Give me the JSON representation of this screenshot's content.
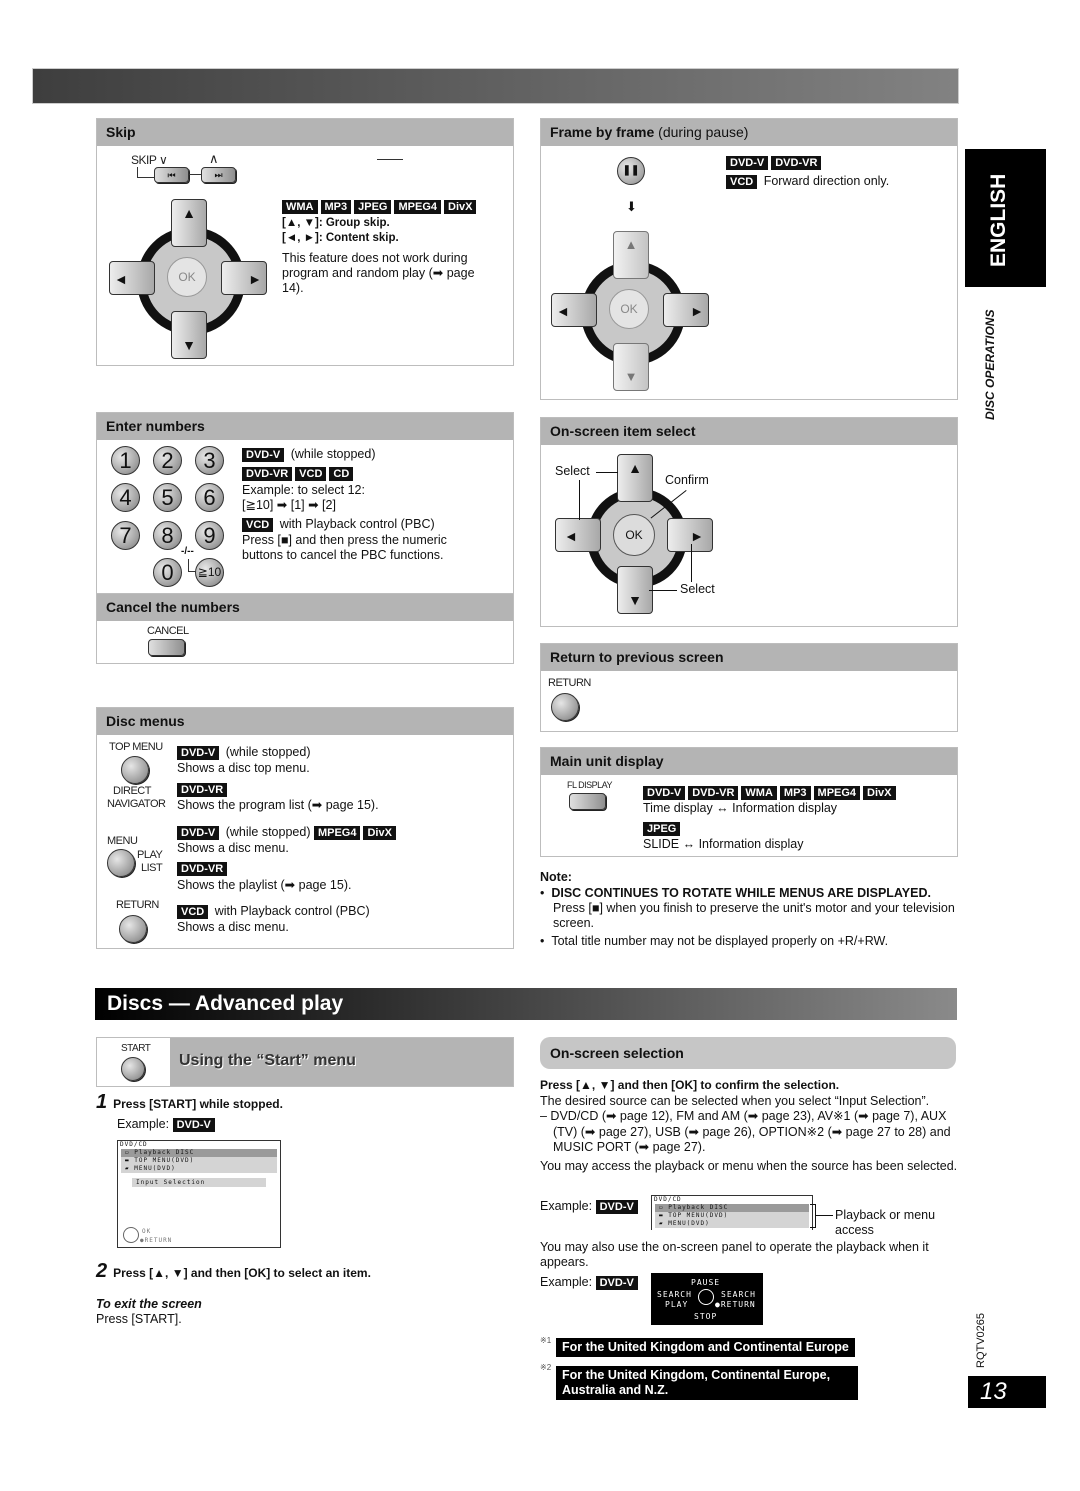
{
  "side": {
    "language_tab": "ENGLISH",
    "section_label": "DISC OPERATIONS",
    "doc_code": "RQTV0265",
    "page_number": "13"
  },
  "skip": {
    "title": "Skip",
    "button_label": "SKIP",
    "down_symbol": "∨",
    "up_symbol": "∧",
    "prev_glyph": "⏮",
    "next_glyph": "⏭",
    "dash": "——",
    "tags": [
      "WMA",
      "MP3",
      "JPEG",
      "MPEG4",
      "DivX"
    ],
    "line1": "[▲, ▼]: Group skip.",
    "line2": "[◄, ►]: Content skip.",
    "note": "This feature does not work during program and random play (➡ page 14).",
    "ok_label": "OK"
  },
  "frame": {
    "title": "Frame by frame",
    "title_suffix": "(during pause)",
    "tags": [
      "DVD-V",
      "DVD-VR"
    ],
    "vcd_tag": "VCD",
    "vcd_note": "Forward direction only.",
    "ok_label": "OK",
    "pause_glyph": "❚❚",
    "arrow_glyph": "⬇"
  },
  "enter_numbers": {
    "title": "Enter numbers",
    "keys": [
      "1",
      "2",
      "3",
      "4",
      "5",
      "6",
      "7",
      "8",
      "9",
      "0",
      "≧10"
    ],
    "dash_label": "-/--",
    "tag1": "DVD-V",
    "tag1_note": "(while stopped)",
    "tags2": [
      "DVD-VR",
      "VCD",
      "CD"
    ],
    "example": "Example: to select 12:",
    "example_seq": "[≧10] ➡ [1] ➡ [2]",
    "vcd_tag": "VCD",
    "vcd_note": "with Playback control (PBC)",
    "vcd_detail": "Press [■] and then press the numeric buttons to cancel the PBC functions."
  },
  "cancel_numbers": {
    "title": "Cancel the numbers",
    "button_label": "CANCEL"
  },
  "onscreen_item": {
    "title": "On-screen item select",
    "select_label_1": "Select",
    "confirm_label": "Confirm",
    "select_label_2": "Select",
    "ok_label": "OK"
  },
  "return_prev": {
    "title": "Return to previous screen",
    "button_label": "RETURN"
  },
  "disc_menus": {
    "title": "Disc menus",
    "top_menu_label": "TOP MENU",
    "direct_nav_label_1": "DIRECT",
    "direct_nav_label_2": "NAVIGATOR",
    "menu_label": "MENU",
    "play_list_label_1": "PLAY",
    "play_list_label_2": "LIST",
    "return_label": "RETURN",
    "item1_tag": "DVD-V",
    "item1_cond": "(while stopped)",
    "item1_text": "Shows a disc top menu.",
    "item2_tag": "DVD-VR",
    "item2_text": "Shows the program list (➡ page 15).",
    "item3_tag": "DVD-V",
    "item3_cond": "(while stopped)",
    "item3_tags": [
      "MPEG4",
      "DivX"
    ],
    "item3_text": "Shows a disc menu.",
    "item4_tag": "DVD-VR",
    "item4_text": "Shows the playlist (➡ page 15).",
    "item5_tag": "VCD",
    "item5_cond": "with Playback control (PBC)",
    "item5_text": "Shows a disc menu."
  },
  "main_display": {
    "title": "Main unit display",
    "button_label": "FL DISPLAY",
    "tags": [
      "DVD-V",
      "DVD-VR",
      "WMA",
      "MP3",
      "MPEG4",
      "DivX"
    ],
    "line1": "Time display ↔ Information display",
    "jpeg_tag": "JPEG",
    "line2": "SLIDE ↔ Information display"
  },
  "note": {
    "heading": "Note:",
    "bullet1_bold": "DISC CONTINUES TO ROTATE WHILE MENUS ARE DISPLAYED.",
    "bullet1_text": "Press [■] when you finish to preserve the unit's motor and your television screen.",
    "bullet2": "Total title number may not be displayed properly on +R/+RW."
  },
  "advanced": {
    "section_title": "Discs — Advanced play",
    "start_button_label": "START",
    "start_title": "Using the “Start” menu",
    "step1_num": "1",
    "step1": "Press [START] while stopped.",
    "example_label": "Example:",
    "example_tag": "DVD-V",
    "osd": {
      "header": "DVD/CD",
      "rows": [
        "Playback DISC",
        "TOP MENU(DVD)",
        "MENU(DVD)"
      ],
      "input": "Input Selection",
      "ok": "OK",
      "ret": "RETURN"
    },
    "step2_num": "2",
    "step2": "Press [▲, ▼] and then [OK] to select an item.",
    "exit_title": "To exit the screen",
    "exit_text": "Press [START]."
  },
  "onscreen_selection": {
    "title": "On-screen selection",
    "lead": "Press [▲, ▼] and then [OK] to confirm the selection.",
    "p1": "The desired source can be selected when you select “Input Selection”.",
    "p2": "– DVD/CD (➡ page 12), FM and AM (➡ page 23), AV※1 (➡ page 7), AUX (TV) (➡ page 27), USB (➡ page 26), OPTION※2 (➡ page 27 to 28) and MUSIC PORT (➡ page 27).",
    "p3": "You may access the playback or menu when the source has been selected.",
    "example_label": "Example:",
    "example_tag": "DVD-V",
    "osd_header": "DVD/CD",
    "osd_rows": [
      "Playback DISC",
      "TOP MENU(DVD)",
      "MENU(DVD)"
    ],
    "callout": "Playback or menu access",
    "p4": "You may also use the on-screen panel to operate the playback when it appears.",
    "example2_label": "Example:",
    "example2_tag": "DVD-V",
    "panel": {
      "pause": "PAUSE",
      "search_left": "SEARCH",
      "search_right": "SEARCH",
      "play": "PLAY",
      "ret": "●RETURN",
      "stop": "STOP"
    },
    "fn1_mark": "※1",
    "fn1": "For the United Kingdom and Continental Europe",
    "fn2_mark": "※2",
    "fn2": "For the United Kingdom, Continental Europe, Australia and N.Z."
  }
}
